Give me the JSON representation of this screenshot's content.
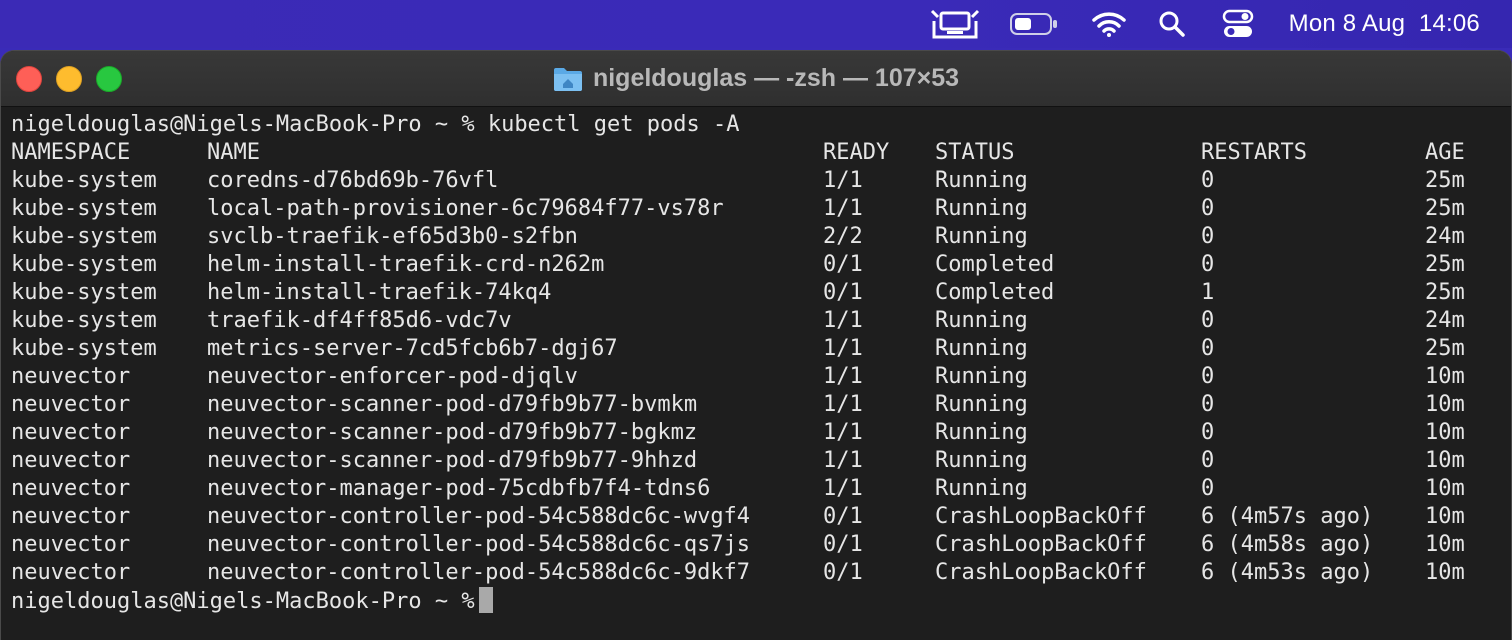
{
  "menubar": {
    "icons": [
      "display-icon",
      "battery-icon",
      "wifi-icon",
      "search-icon",
      "control-center-icon"
    ],
    "clock": "Mon 8 Aug  14:06"
  },
  "window": {
    "title": "nigeldouglas — -zsh — 107×53"
  },
  "terminal": {
    "command_line": "nigeldouglas@Nigels-MacBook-Pro ~ % kubectl get pods -A",
    "headers": {
      "namespace": "NAMESPACE",
      "name": "NAME",
      "ready": "READY",
      "status": "STATUS",
      "restarts": "RESTARTS",
      "age": "AGE"
    },
    "rows": [
      {
        "namespace": "kube-system",
        "name": "coredns-d76bd69b-76vfl",
        "ready": "1/1",
        "status": "Running",
        "restarts": "0",
        "age": "25m"
      },
      {
        "namespace": "kube-system",
        "name": "local-path-provisioner-6c79684f77-vs78r",
        "ready": "1/1",
        "status": "Running",
        "restarts": "0",
        "age": "25m"
      },
      {
        "namespace": "kube-system",
        "name": "svclb-traefik-ef65d3b0-s2fbn",
        "ready": "2/2",
        "status": "Running",
        "restarts": "0",
        "age": "24m"
      },
      {
        "namespace": "kube-system",
        "name": "helm-install-traefik-crd-n262m",
        "ready": "0/1",
        "status": "Completed",
        "restarts": "0",
        "age": "25m"
      },
      {
        "namespace": "kube-system",
        "name": "helm-install-traefik-74kq4",
        "ready": "0/1",
        "status": "Completed",
        "restarts": "1",
        "age": "25m"
      },
      {
        "namespace": "kube-system",
        "name": "traefik-df4ff85d6-vdc7v",
        "ready": "1/1",
        "status": "Running",
        "restarts": "0",
        "age": "24m"
      },
      {
        "namespace": "kube-system",
        "name": "metrics-server-7cd5fcb6b7-dgj67",
        "ready": "1/1",
        "status": "Running",
        "restarts": "0",
        "age": "25m"
      },
      {
        "namespace": "neuvector",
        "name": "neuvector-enforcer-pod-djqlv",
        "ready": "1/1",
        "status": "Running",
        "restarts": "0",
        "age": "10m"
      },
      {
        "namespace": "neuvector",
        "name": "neuvector-scanner-pod-d79fb9b77-bvmkm",
        "ready": "1/1",
        "status": "Running",
        "restarts": "0",
        "age": "10m"
      },
      {
        "namespace": "neuvector",
        "name": "neuvector-scanner-pod-d79fb9b77-bgkmz",
        "ready": "1/1",
        "status": "Running",
        "restarts": "0",
        "age": "10m"
      },
      {
        "namespace": "neuvector",
        "name": "neuvector-scanner-pod-d79fb9b77-9hhzd",
        "ready": "1/1",
        "status": "Running",
        "restarts": "0",
        "age": "10m"
      },
      {
        "namespace": "neuvector",
        "name": "neuvector-manager-pod-75cdbfb7f4-tdns6",
        "ready": "1/1",
        "status": "Running",
        "restarts": "0",
        "age": "10m"
      },
      {
        "namespace": "neuvector",
        "name": "neuvector-controller-pod-54c588dc6c-wvgf4",
        "ready": "0/1",
        "status": "CrashLoopBackOff",
        "restarts": "6 (4m57s ago)",
        "age": "10m"
      },
      {
        "namespace": "neuvector",
        "name": "neuvector-controller-pod-54c588dc6c-qs7js",
        "ready": "0/1",
        "status": "CrashLoopBackOff",
        "restarts": "6 (4m58s ago)",
        "age": "10m"
      },
      {
        "namespace": "neuvector",
        "name": "neuvector-controller-pod-54c588dc6c-9dkf7",
        "ready": "0/1",
        "status": "CrashLoopBackOff",
        "restarts": "6 (4m53s ago)",
        "age": "10m"
      }
    ],
    "prompt": "nigeldouglas@Nigels-MacBook-Pro ~ %"
  },
  "colors": {
    "menubar_bg": "#3a2ab8",
    "terminal_bg": "#1e1e1e",
    "terminal_fg": "#e6e6e6",
    "close": "#fe5f57",
    "minimize": "#febc2e",
    "zoom": "#28c840"
  }
}
